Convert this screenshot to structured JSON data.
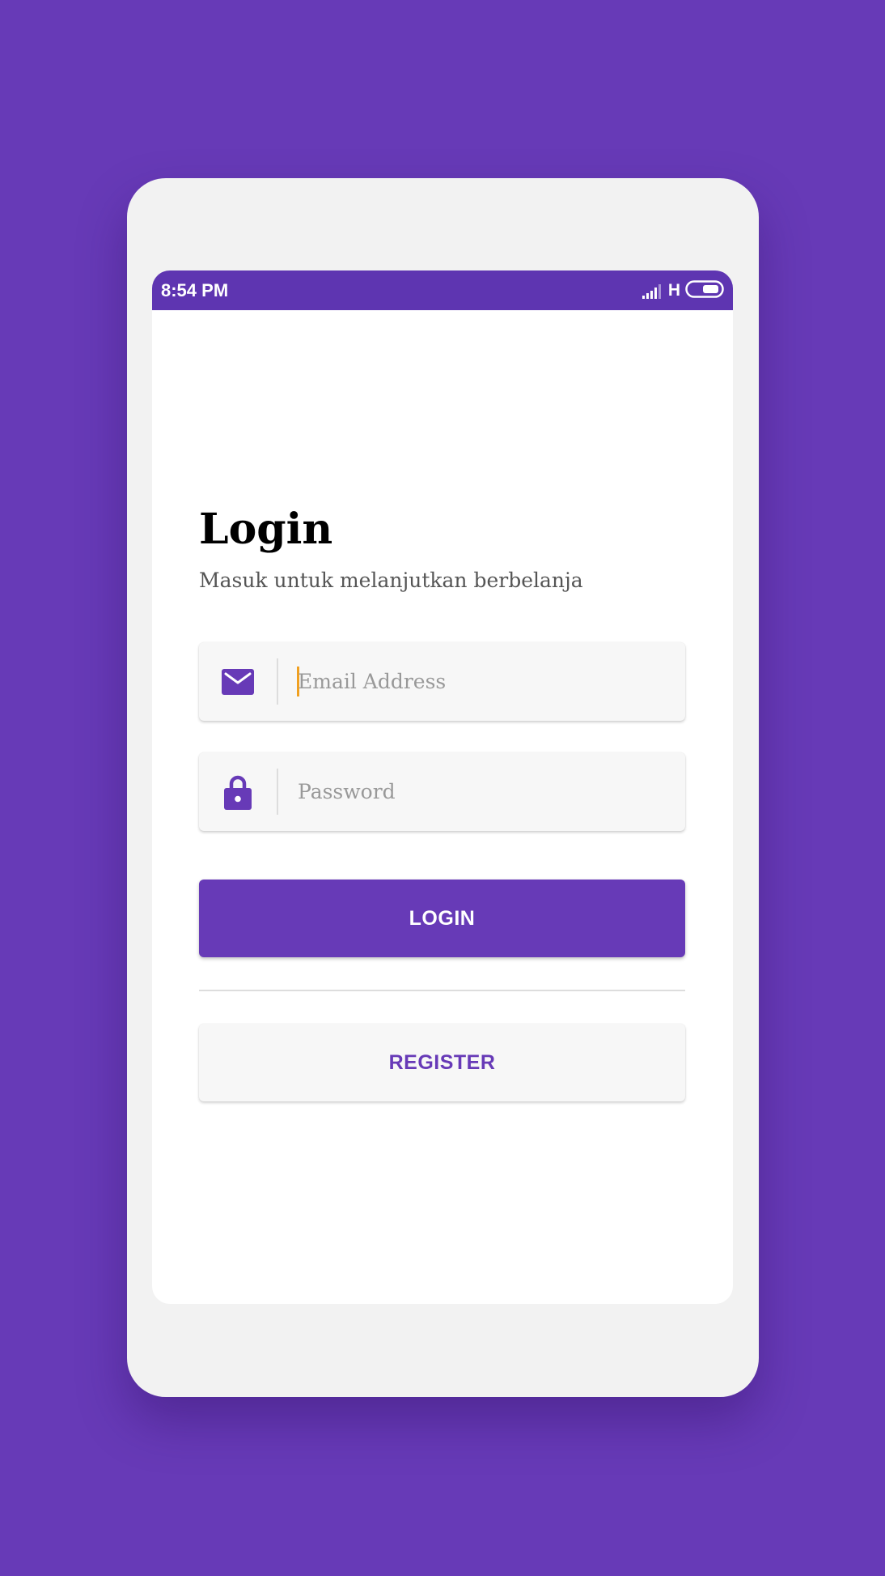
{
  "status_bar": {
    "time": "8:54 PM",
    "network_type": "H",
    "icons": [
      "signal-icon",
      "battery-icon"
    ]
  },
  "login": {
    "title": "Login",
    "subtitle": "Masuk untuk melanjutkan berbelanja",
    "email": {
      "placeholder": "Email Address",
      "value": "",
      "icon": "mail-icon"
    },
    "password": {
      "placeholder": "Password",
      "value": "",
      "icon": "lock-icon"
    },
    "login_button_label": "LOGIN",
    "register_button_label": "REGISTER"
  },
  "colors": {
    "background": "#673AB7",
    "status_bar": "#5E35B1",
    "accent": "#673AB7",
    "caret": "#F0A020"
  }
}
